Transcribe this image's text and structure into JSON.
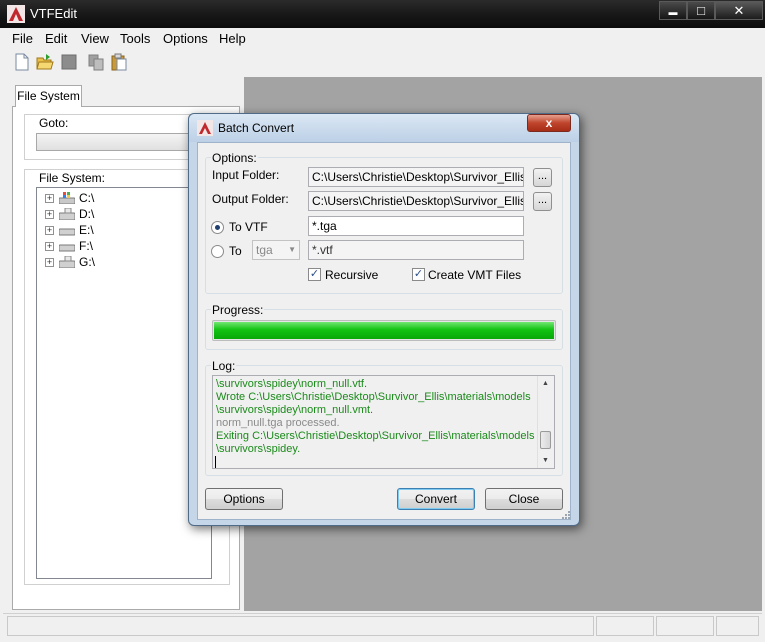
{
  "window": {
    "title": "VTFEdit",
    "minimize": "▬",
    "maximize": "□",
    "close": "✕"
  },
  "menu": [
    "File",
    "Edit",
    "View",
    "Tools",
    "Options",
    "Help"
  ],
  "toolbar": {
    "icons": [
      "new-file-icon",
      "open-folder-icon",
      "save-icon",
      "copy-icon",
      "paste-icon"
    ]
  },
  "left_panel": {
    "tab": "File System",
    "goto_label": "Goto:",
    "goto_value": "",
    "fs_label": "File System:",
    "drives": [
      {
        "label": "C:\\",
        "expander": "+"
      },
      {
        "label": "D:\\",
        "expander": "+"
      },
      {
        "label": "E:\\",
        "expander": "+"
      },
      {
        "label": "F:\\",
        "expander": "+"
      },
      {
        "label": "G:\\",
        "expander": "+"
      }
    ]
  },
  "dialog": {
    "title": "Batch Convert",
    "close_glyph": "x",
    "options_group": "Options:",
    "input_folder_label": "Input Folder:",
    "input_folder_value": "C:\\Users\\Christie\\Desktop\\Survivor_Ellis\\ma",
    "output_folder_label": "Output Folder:",
    "output_folder_value": "C:\\Users\\Christie\\Desktop\\Survivor_Ellis\\ma",
    "browse_label": "...",
    "to_vtf_label": "To VTF",
    "to_vtf_selected": true,
    "to_vtf_filter": "*.tga",
    "to_label": "To",
    "to_format": "tga",
    "to_filter": "*.vtf",
    "recursive_label": "Recursive",
    "recursive_checked": true,
    "create_vmt_label": "Create VMT Files",
    "create_vmt_checked": true,
    "progress_group": "Progress:",
    "progress_value": 1.0,
    "log_group": "Log:",
    "log_lines": [
      {
        "text": "\\survivors\\spidey\\norm_null.vtf.",
        "color": "#1a8a1a"
      },
      {
        "text": "Wrote C:\\Users\\Christie\\Desktop\\Survivor_Ellis\\materials\\models",
        "color": "#1a8a1a"
      },
      {
        "text": "\\survivors\\spidey\\norm_null.vmt.",
        "color": "#1a8a1a"
      },
      {
        "text": "norm_null.tga processed.",
        "color": "#8a8a8a"
      },
      {
        "text": "Exiting C:\\Users\\Christie\\Desktop\\Survivor_Ellis\\materials\\models",
        "color": "#1a8a1a"
      },
      {
        "text": "\\survivors\\spidey.",
        "color": "#1a8a1a"
      }
    ],
    "options_button": "Options",
    "convert_button": "Convert",
    "close_button": "Close"
  },
  "colors": {
    "accent_green": "#12c212",
    "log_green": "#1a8a1a",
    "log_gray": "#8a8a8a",
    "workspace": "#a3a3a3"
  }
}
